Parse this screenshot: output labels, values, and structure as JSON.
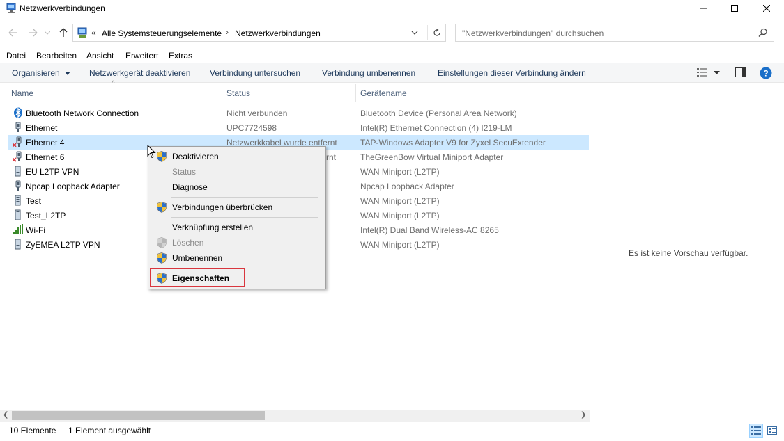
{
  "window": {
    "title": "Netzwerkverbindungen"
  },
  "address": {
    "crumb_prefix": "«",
    "crumb1": "Alle Systemsteuerungselemente",
    "crumb2": "Netzwerkverbindungen",
    "separator": "›"
  },
  "search": {
    "placeholder": "\"Netzwerkverbindungen\" durchsuchen"
  },
  "menu": [
    "Datei",
    "Bearbeiten",
    "Ansicht",
    "Erweitert",
    "Extras"
  ],
  "commands": {
    "organize": "Organisieren",
    "disable": "Netzwerkgerät deaktivieren",
    "diagnose": "Verbindung untersuchen",
    "rename": "Verbindung umbenennen",
    "settings": "Einstellungen dieser Verbindung ändern"
  },
  "columns": {
    "name": "Name",
    "status": "Status",
    "device": "Gerätename"
  },
  "rows": [
    {
      "name": "Bluetooth Network Connection",
      "status": "Nicht verbunden",
      "device": "Bluetooth Device (Personal Area Network)",
      "icon": "bluetooth-icon"
    },
    {
      "name": "Ethernet",
      "status": "UPC7724598",
      "device": "Intel(R) Ethernet Connection (4) I219-LM",
      "icon": "ethernet-icon"
    },
    {
      "name": "Ethernet 4",
      "status": "Netzwerkkabel wurde entfernt",
      "device": "TAP-Windows Adapter V9 for Zyxel SecuExtender",
      "icon": "ethernet-disconnected-icon"
    },
    {
      "name": "Ethernet 6",
      "status": "rnt",
      "device": "TheGreenBow Virtual Miniport Adapter",
      "icon": "ethernet-disconnected-icon"
    },
    {
      "name": "EU L2TP VPN",
      "status": "",
      "device": "WAN Miniport (L2TP)",
      "icon": "vpn-icon"
    },
    {
      "name": "Npcap Loopback Adapter",
      "status": "",
      "device": "Npcap Loopback Adapter",
      "icon": "ethernet-icon"
    },
    {
      "name": "Test",
      "status": "",
      "device": "WAN Miniport (L2TP)",
      "icon": "vpn-icon"
    },
    {
      "name": "Test_L2TP",
      "status": "",
      "device": "WAN Miniport (L2TP)",
      "icon": "vpn-icon"
    },
    {
      "name": "Wi-Fi",
      "status": "",
      "device": "Intel(R) Dual Band Wireless-AC 8265",
      "icon": "wifi-icon"
    },
    {
      "name": "ZyEMEA L2TP VPN",
      "status": "",
      "device": "WAN Miniport (L2TP)",
      "icon": "vpn-icon"
    }
  ],
  "context_menu": {
    "items": [
      {
        "label": "Deaktivieren",
        "shield": true,
        "disabled": false
      },
      {
        "label": "Status",
        "shield": false,
        "disabled": true
      },
      {
        "label": "Diagnose",
        "shield": false,
        "disabled": false
      },
      {
        "label": "Verbindungen überbrücken",
        "shield": true,
        "disabled": false
      },
      {
        "label": "Verknüpfung erstellen",
        "shield": false,
        "disabled": false
      },
      {
        "label": "Löschen",
        "shield": true,
        "disabled": true
      },
      {
        "label": "Umbenennen",
        "shield": true,
        "disabled": false
      },
      {
        "label": "Eigenschaften",
        "shield": true,
        "disabled": false,
        "bold": true
      }
    ]
  },
  "preview": {
    "empty_text": "Es ist keine Vorschau verfügbar."
  },
  "statusbar": {
    "count": "10 Elemente",
    "selected": "1 Element ausgewählt"
  },
  "colors": {
    "selection": "#cce8ff",
    "highlight_border": "#d9363e",
    "help": "#1a6fc9"
  }
}
